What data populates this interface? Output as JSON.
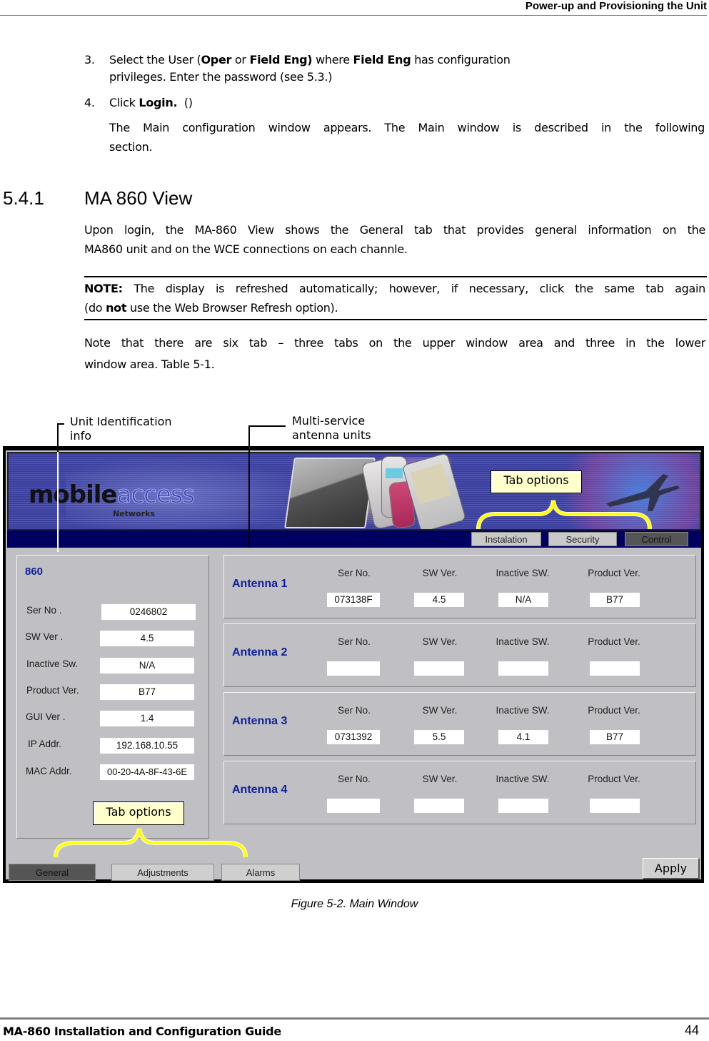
{
  "header": {
    "title": "Power-up and Provisioning the Unit"
  },
  "steps": [
    {
      "num": "3.",
      "parts": [
        "Select the User (",
        "Oper",
        " or ",
        "Field Eng)",
        " where ",
        "Field Eng",
        " has configuration"
      ],
      "line2": "privileges. Enter the password (see 5.3.)"
    },
    {
      "num": "4.",
      "pre": "Click ",
      "bold": "Login.",
      "post": "  ()",
      "desc_line1": "The Main configuration window appears. The Main window is described in the following",
      "desc_line2": "section."
    }
  ],
  "section": {
    "number": "5.4.1",
    "title": "MA 860 View",
    "para_line1": "Upon login, the MA-860 View shows the General tab that provides general information on the",
    "para_line2": "MA860 unit and on the WCE connections on each channle."
  },
  "note": {
    "label": "NOTE:",
    "line1": " The display is refreshed automatically; however, if necessary, click the same tab again",
    "line2_pre": "(do ",
    "line2_bold": "not",
    "line2_post": " use the Web Browser Refresh option)."
  },
  "para2": {
    "line1": "Note that there are six tab – three tabs on the upper window area and three in the lower",
    "line2": "window area. Table 5-1."
  },
  "callouts": {
    "unit_id_line1": "Unit Identification",
    "unit_id_line2": "info",
    "multi_line1": "Multi-service",
    "multi_line2": "antenna units",
    "tab_options_top": "Tab options",
    "tab_options_bottom": "Tab options"
  },
  "app": {
    "logo_main": "mobile",
    "logo_accent": "access",
    "logo_sub": "Networks",
    "top_tabs": [
      {
        "label": "Instalation",
        "active": false
      },
      {
        "label": "Security",
        "active": false
      },
      {
        "label": "Control",
        "active": true
      }
    ],
    "unit": {
      "title": "860",
      "fields": [
        {
          "label": "Ser No .",
          "value": "0246802"
        },
        {
          "label": "SW Ver .",
          "value": "4.5"
        },
        {
          "label": "Inactive Sw.",
          "value": "N/A"
        },
        {
          "label": "Product Ver.",
          "value": "B77"
        },
        {
          "label": "GUI Ver .",
          "value": "1.4"
        },
        {
          "label": "IP Addr.",
          "value": "192.168.10.55"
        },
        {
          "label": "MAC Addr.",
          "value": "00-20-4A-8F-43-6E"
        }
      ]
    },
    "antenna_columns": [
      "Ser No.",
      "SW Ver.",
      "Inactive SW.",
      "Product Ver."
    ],
    "antennas": [
      {
        "name": "Antenna 1",
        "values": [
          "073138F",
          "4.5",
          "N/A",
          "B77"
        ]
      },
      {
        "name": "Antenna 2",
        "values": [
          "",
          "",
          "",
          ""
        ]
      },
      {
        "name": "Antenna 3",
        "values": [
          "0731392",
          "5.5",
          "4.1",
          "B77"
        ]
      },
      {
        "name": "Antenna 4",
        "values": [
          "",
          "",
          "",
          ""
        ]
      }
    ],
    "bottom_tabs": [
      {
        "label": "General",
        "active": true
      },
      {
        "label": "Adjustments",
        "active": false
      },
      {
        "label": "Alarms",
        "active": false
      }
    ],
    "apply_label": "Apply",
    "colors": {
      "nav_bar": "#000060",
      "title_blue": "#0f2299",
      "panel_gray": "#c0bfc3",
      "callout_yellow": "#ffff00",
      "tab_options_bg": "#ffffcc"
    }
  },
  "caption": "Figure 5-2. Main Window",
  "footer": {
    "left": "MA-860 Installation and Configuration Guide",
    "page": "44"
  }
}
